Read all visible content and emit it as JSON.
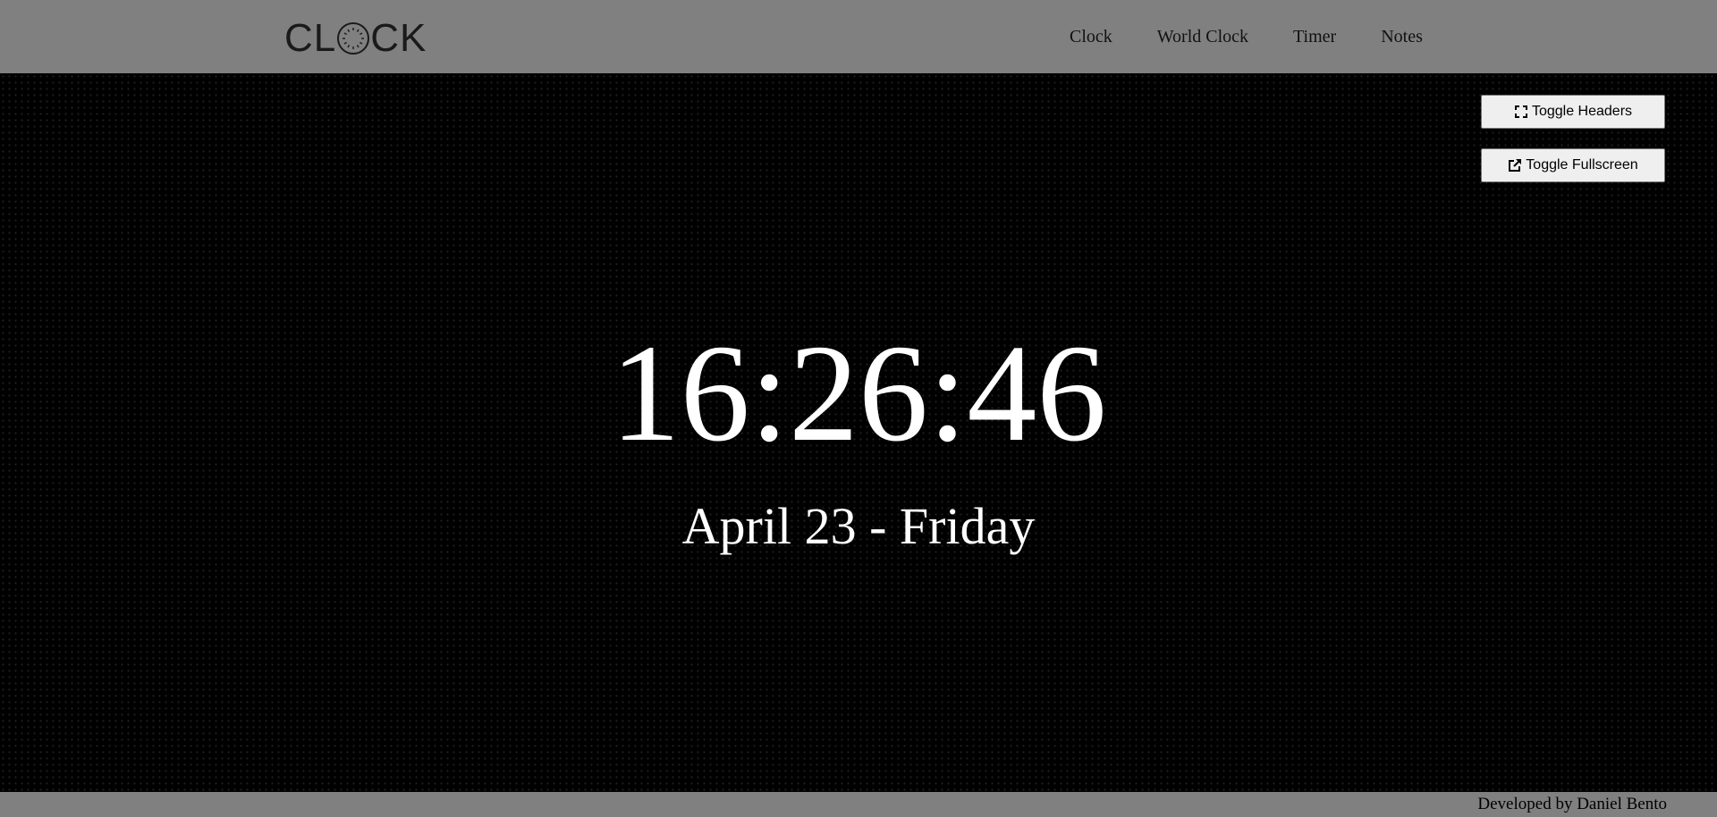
{
  "header": {
    "logo_parts": {
      "before": "CL",
      "after": "CK"
    },
    "nav": [
      {
        "label": "Clock"
      },
      {
        "label": "World Clock"
      },
      {
        "label": "Timer"
      },
      {
        "label": "Notes"
      }
    ]
  },
  "controls": {
    "toggle_headers": {
      "label": "Toggle Headers",
      "icon": "expand-icon"
    },
    "toggle_fullscreen": {
      "label": "Toggle Fullscreen",
      "icon": "external-link-icon"
    }
  },
  "clock": {
    "time": "16:26:46",
    "date": "April 23 - Friday"
  },
  "footer": {
    "credit": "Developed by Daniel Bento"
  },
  "colors": {
    "header_bg": "#808080",
    "main_bg": "#000000",
    "text": "#ffffff"
  }
}
